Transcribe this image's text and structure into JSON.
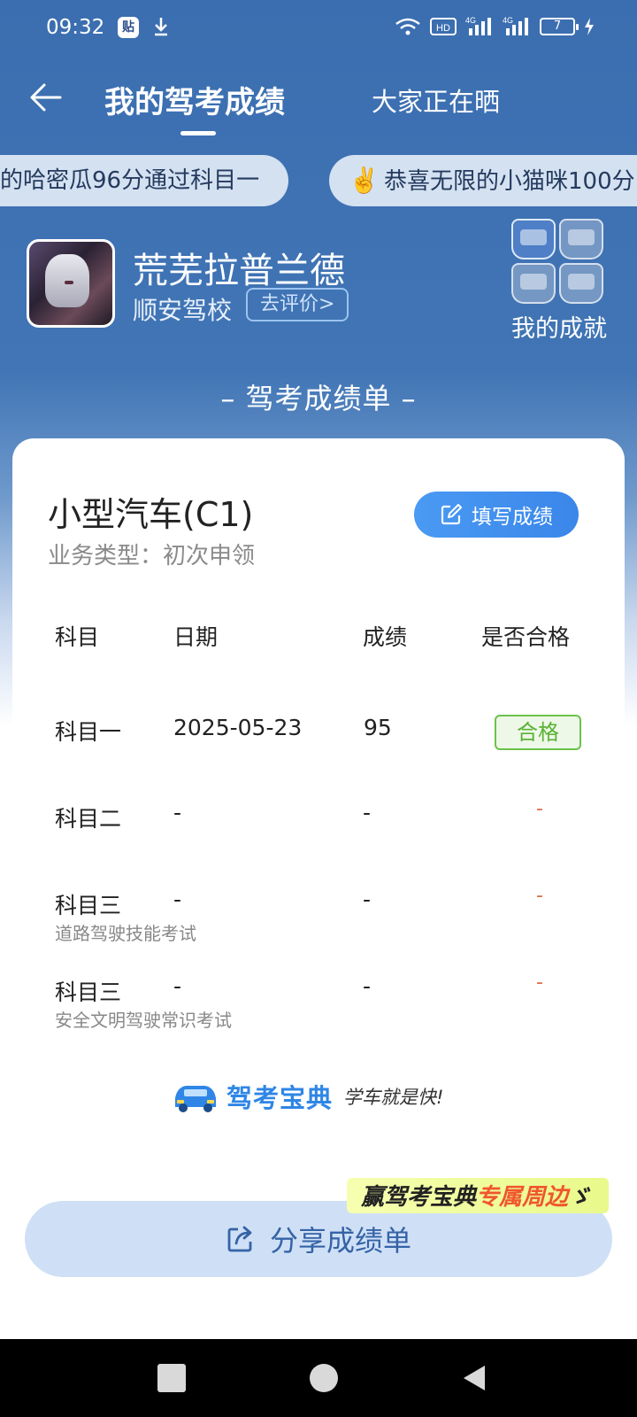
{
  "status_bar": {
    "time": "09:32",
    "app_badge": "贴",
    "battery": "7",
    "network": "4G"
  },
  "header": {
    "tab_mine": "我的驾考成绩",
    "tab_others": "大家正在晒"
  },
  "ticker": {
    "items": [
      "的哈密瓜96分通过科目一",
      "恭喜无限的小猫咪100分"
    ],
    "emoji": "✌️"
  },
  "profile": {
    "name": "荒芜拉普兰德",
    "school": "顺安驾校",
    "rate_label": "去评价>",
    "achievements_label": "我的成就"
  },
  "sheet_title": "– 驾考成绩单 –",
  "card": {
    "car_type": "小型汽车(C1)",
    "business_type": "业务类型：初次申领",
    "fill_button": "填写成绩",
    "columns": [
      "科目",
      "日期",
      "成绩",
      "是否合格"
    ],
    "rows": [
      {
        "subject": "科目一",
        "note": "",
        "date": "2025-05-23",
        "score": "95",
        "result": "合格"
      },
      {
        "subject": "科目二",
        "note": "",
        "date": "-",
        "score": "-",
        "result": "-"
      },
      {
        "subject": "科目三",
        "note": "道路驾驶技能考试",
        "date": "-",
        "score": "-",
        "result": "-"
      },
      {
        "subject": "科目三",
        "note": "安全文明驾驶常识考试",
        "date": "-",
        "score": "-",
        "result": "-"
      }
    ],
    "brand_name": "驾考宝典",
    "brand_slogan": "学车就是快!"
  },
  "promo": {
    "prefix": "赢驾考宝典",
    "highlight": "专属周边",
    "suffix": "ゞ"
  },
  "share_button": "分享成绩单",
  "colors": {
    "header_blue": "#3b6eb0",
    "accent_blue": "#3a86ea",
    "pass_green": "#5bb236",
    "dash_red": "#e06a4a"
  }
}
